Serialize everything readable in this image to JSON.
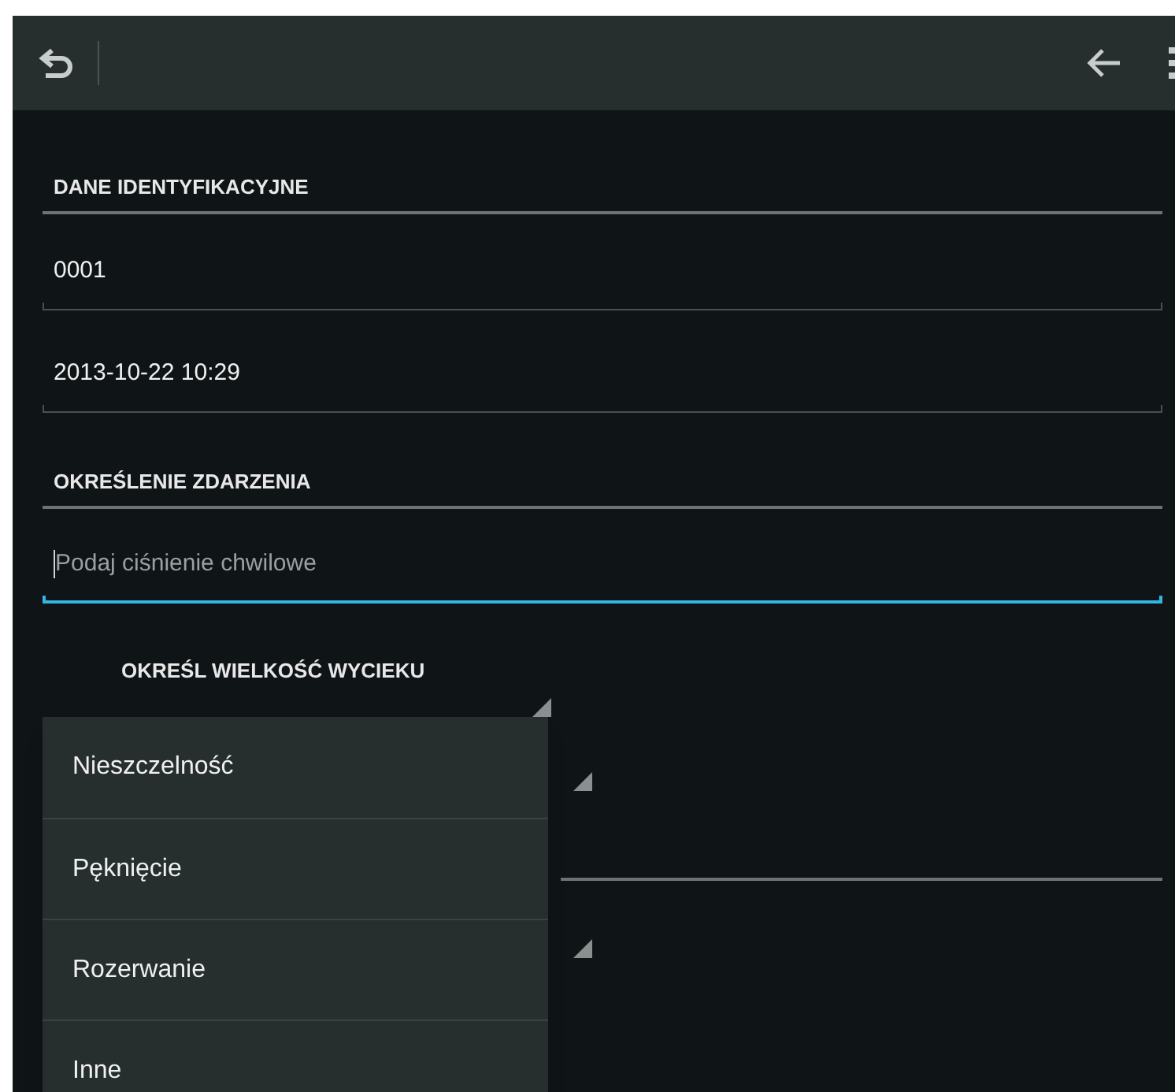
{
  "sections": [
    {
      "heading": "DANE IDENTYFIKACYJNE",
      "fields": [
        {
          "kind": "text",
          "value": "0001"
        },
        {
          "kind": "text",
          "value": "2013-10-22 10:29"
        }
      ]
    },
    {
      "heading": "OKREŚLENIE ZDARZENIA",
      "fields": [
        {
          "kind": "input",
          "placeholder": "Podaj ciśnienie chwilowe",
          "focused": true
        }
      ]
    }
  ],
  "spinner": {
    "label": "OKREŚL WIELKOŚĆ WYCIEKU"
  },
  "dropdown": {
    "options": [
      {
        "label": "Nieszczelność"
      },
      {
        "label": "Pęknięcie"
      },
      {
        "label": "Rozerwanie"
      },
      {
        "label": "Inne"
      }
    ]
  }
}
